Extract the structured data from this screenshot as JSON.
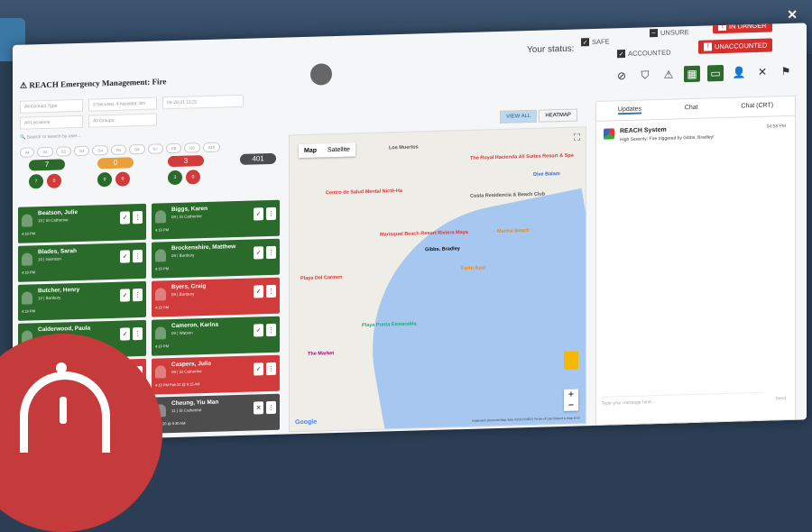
{
  "window": {
    "close_icon": "close-icon"
  },
  "app": {
    "title": "REACH Emergency Management: Fire"
  },
  "status": {
    "label": "Your status:",
    "safe": "SAFE",
    "unsure": "UNSURE",
    "accounted": "ACCOUNTED",
    "in_danger": "IN DANGER",
    "unaccounted": "UNACCOUNTED",
    "danger_color": "#d62d2d"
  },
  "toolbar": {
    "icons": [
      "block-icon",
      "shield-icon",
      "warning-icon",
      "map-icon",
      "chat-icon",
      "user-check-icon",
      "close-icon",
      "flag-icon"
    ]
  },
  "filters": {
    "contact_type": "All Contact Type",
    "secondary": "2 Secured, 4 Assisted, 8m",
    "date": "04-29-21 11:22",
    "location": "All Locations",
    "groups": "All Groups",
    "search_placeholder": "Search or search by user..."
  },
  "tags": [
    "All",
    "G1",
    "G2",
    "G3",
    "G4",
    "G5",
    "G6",
    "G7",
    "G8",
    "G9",
    "G10"
  ],
  "counts": {
    "safe": "7",
    "unsure": "0",
    "danger": "3",
    "total": "401",
    "safe_sub": [
      "7",
      "0"
    ],
    "unsure_sub": [
      "0",
      "0"
    ],
    "danger_sub": [
      "3",
      "0"
    ]
  },
  "people": [
    {
      "name": "Beatson, Julie",
      "detail": "10 | St Catherine",
      "time": "4:19 PM",
      "state": "green"
    },
    {
      "name": "Biggs, Karen",
      "detail": "09 | St Catherine",
      "time": "4:19 PM",
      "state": "green"
    },
    {
      "name": "Blades, Sarah",
      "detail": "10 | Garrison",
      "time": "4:19 PM",
      "state": "green"
    },
    {
      "name": "Brockenshire, Matthew",
      "detail": "09 | Bunbury",
      "time": "4:19 PM",
      "state": "green"
    },
    {
      "name": "Butcher, Henry",
      "detail": "12 | Bunbury",
      "time": "4:19 PM",
      "state": "green"
    },
    {
      "name": "Byers, Craig",
      "detail": "09 | Bunbury",
      "time": "4:19 PM",
      "state": "red"
    },
    {
      "name": "Calderwood, Paula",
      "detail": "",
      "time": "",
      "state": "green"
    },
    {
      "name": "Cameron, Karina",
      "detail": "09 | Watson",
      "time": "4:19 PM",
      "state": "green"
    },
    {
      "name": "",
      "detail": "",
      "time": "",
      "state": "red"
    },
    {
      "name": "Caspers, Julie",
      "detail": "09 | St Catherine",
      "time": "4:19 PM  Feb 20 @ 9:15 AM",
      "state": "red"
    },
    {
      "name": "",
      "detail": "",
      "time": "",
      "state": "grey"
    },
    {
      "name": "Cheung, Yiu Man",
      "detail": "11 | St Catherine",
      "time": "Feb 20 @ 9:30 AM",
      "state": "grey"
    }
  ],
  "map": {
    "view_all": "VIEW ALL",
    "heatmap": "HEATMAP",
    "tab_map": "Map",
    "tab_satellite": "Satellite",
    "pois": [
      "The Royal Hacienda All Suites Resort & Spa",
      "Costa Residencia & Beach Club",
      "Marisquel Beach Resort Riviera Maya",
      "Gibbs, Bradley",
      "Playa Punta Esmeralda",
      "The Market",
      "Centro de Salud Mental Nicté-Ha",
      "Dive Balam",
      "Farro Azul",
      "Marina Beach",
      "Los Muertos",
      "Playa Del Carmen"
    ],
    "footer": "Keyboard shortcuts   Map data ©2023 INEGI   Terms of Use   Report a map error",
    "google": "Google"
  },
  "chat": {
    "tabs": [
      "Updates",
      "Chat",
      "Chat (CRT)"
    ],
    "messages": [
      {
        "from": "REACH System",
        "time": "04:58 PM",
        "body": "High Severity: Fire triggered by Gibbs, Bradley!"
      }
    ],
    "placeholder": "Type your message here...",
    "send": "Send"
  }
}
